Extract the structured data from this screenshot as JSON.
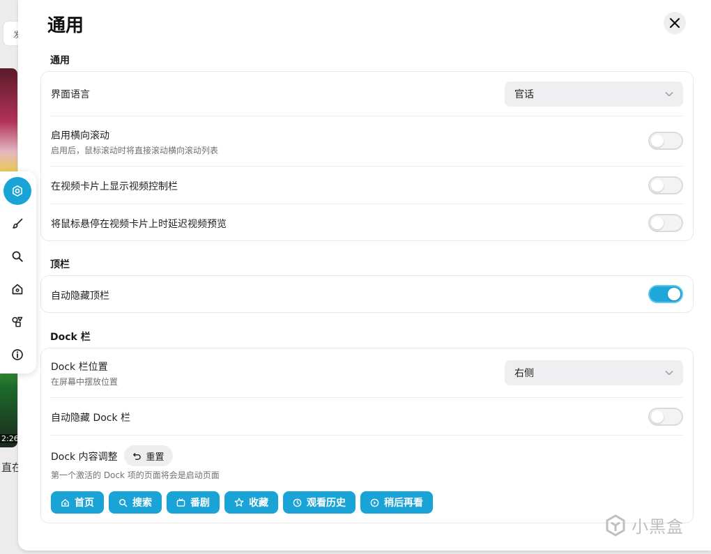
{
  "background": {
    "chip_text": "发",
    "video_duration": "2:26",
    "caption_fragment": "直在"
  },
  "panel": {
    "title": "通用",
    "close_icon": "close-icon"
  },
  "sections": {
    "general": {
      "label": "通用",
      "language": {
        "title": "界面语言",
        "value": "官话"
      },
      "horizontal_scroll": {
        "title": "启用横向滚动",
        "desc": "启用后，鼠标滚动时将直接滚动横向滚动列表",
        "on": false
      },
      "show_controls": {
        "title": "在视频卡片上显示视频控制栏",
        "on": false
      },
      "delay_preview": {
        "title": "将鼠标悬停在视频卡片上时延迟视频预览",
        "on": false
      }
    },
    "topbar": {
      "label": "顶栏",
      "auto_hide": {
        "title": "自动隐藏顶栏",
        "on": true
      }
    },
    "dock": {
      "label": "Dock 栏",
      "position": {
        "title": "Dock 栏位置",
        "desc": "在屏幕中摆放位置",
        "value": "右侧"
      },
      "auto_hide": {
        "title": "自动隐藏 Dock 栏",
        "on": false
      },
      "content": {
        "title": "Dock 内容调整",
        "reset_label": "重置",
        "desc": "第一个激活的 Dock 项的页面将会是启动页面",
        "items": [
          {
            "label": "首页",
            "icon": "home-icon"
          },
          {
            "label": "搜索",
            "icon": "search-icon"
          },
          {
            "label": "番剧",
            "icon": "tv-icon"
          },
          {
            "label": "收藏",
            "icon": "star-icon"
          },
          {
            "label": "观看历史",
            "icon": "clock-icon"
          },
          {
            "label": "稍后再看",
            "icon": "watch-later-icon"
          }
        ]
      }
    }
  },
  "side_dock": {
    "items": [
      {
        "icon": "gear-icon",
        "active": true
      },
      {
        "icon": "brush-icon",
        "active": false
      },
      {
        "icon": "search-icon",
        "active": false
      },
      {
        "icon": "home-icon",
        "active": false
      },
      {
        "icon": "shapes-icon",
        "active": false
      },
      {
        "icon": "info-icon",
        "active": false
      }
    ]
  },
  "watermark": {
    "text": "小黑盒"
  },
  "colors": {
    "accent": "#19a3d6",
    "toggle_on": "#1ea7d9",
    "panel_bg": "#ffffff",
    "muted_text": "#6f6f6f"
  }
}
